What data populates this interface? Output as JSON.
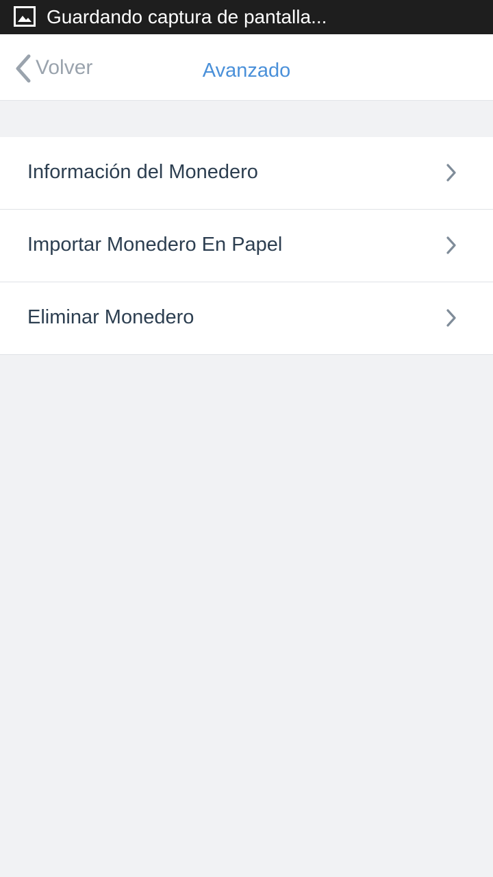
{
  "status_bar": {
    "icon": "image-icon",
    "text": "Guardando captura de pantalla..."
  },
  "nav": {
    "back_label": "Volver",
    "back_icon": "chevron-left-icon",
    "title": "Avanzado"
  },
  "menu": {
    "items": [
      {
        "label": "Información del Monedero",
        "icon": "chevron-right-icon"
      },
      {
        "label": "Importar Monedero En Papel",
        "icon": "chevron-right-icon"
      },
      {
        "label": "Eliminar Monedero",
        "icon": "chevron-right-icon"
      }
    ]
  },
  "colors": {
    "accent": "#4a90d9",
    "status_bar_bg": "#1e1e1e",
    "page_bg": "#f1f2f4",
    "text": "#2c3e50",
    "muted": "#9aa3ad"
  }
}
